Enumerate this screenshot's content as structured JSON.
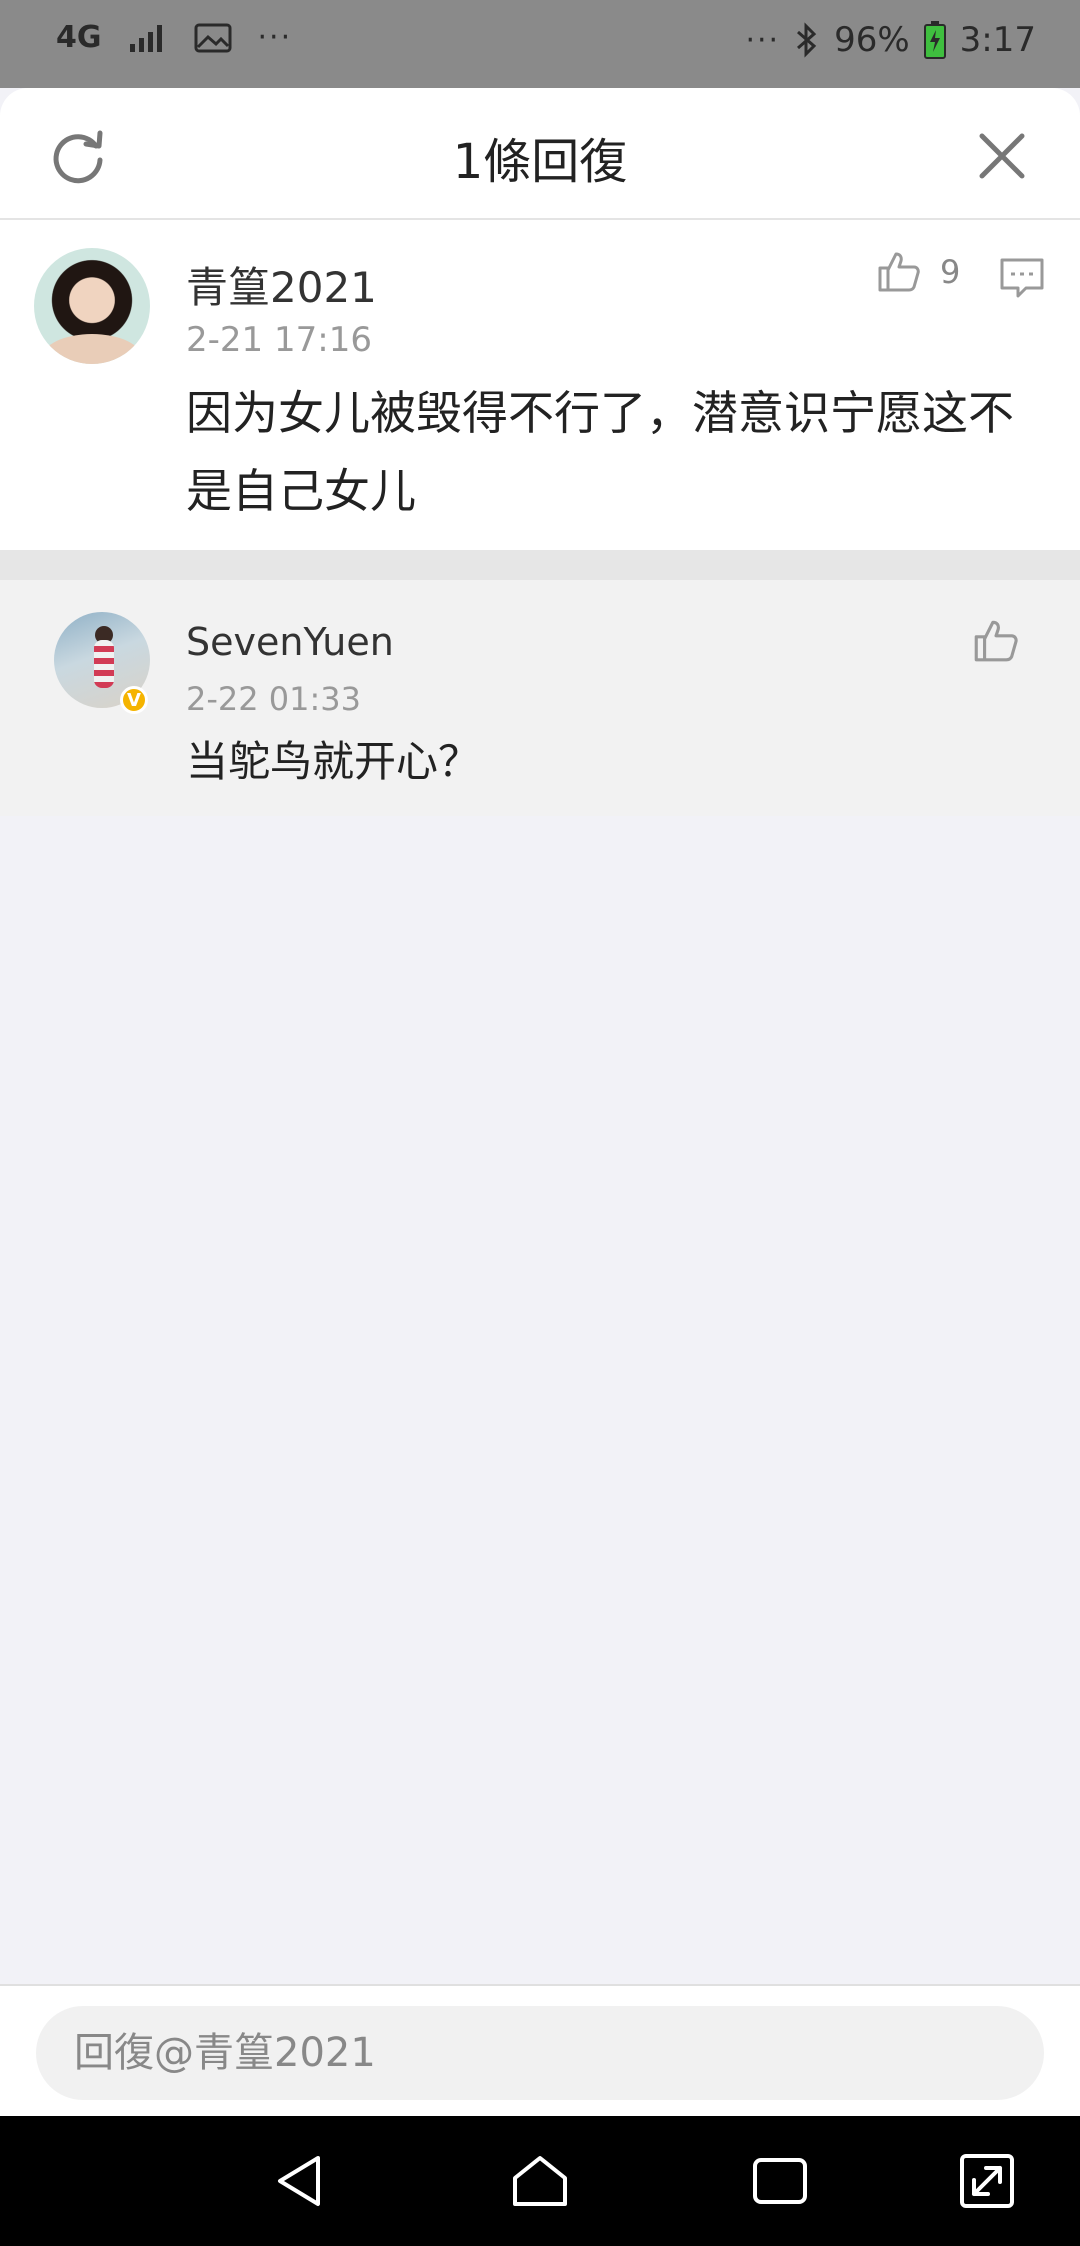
{
  "status_bar": {
    "network": "4G",
    "dots_left": "···",
    "dots_right": "···",
    "battery": "96%",
    "time": "3:17"
  },
  "header": {
    "title": "1條回復"
  },
  "main_comment": {
    "username": "青篁2021",
    "time": "2-21 17:16",
    "text": "因为女儿被毁得不行了，潜意识宁愿这不是自己女儿",
    "like_count": "9"
  },
  "reply": {
    "username": "SevenYuen",
    "time": "2-22 01:33",
    "text": "当鸵鸟就开心？",
    "verified_mark": "V"
  },
  "input": {
    "placeholder": "回復@青篁2021"
  },
  "colors": {
    "sheet_bg": "#f2f2f7",
    "verified": "#f5b400"
  }
}
